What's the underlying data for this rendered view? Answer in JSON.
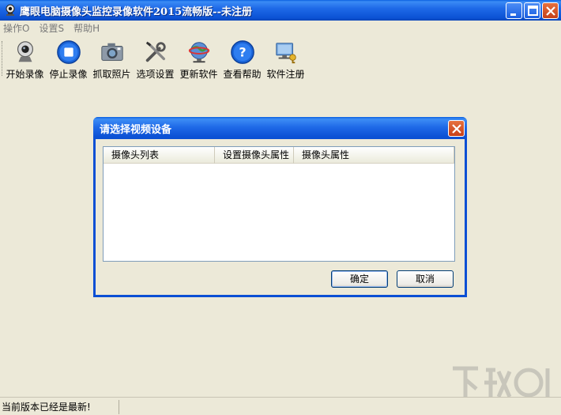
{
  "window": {
    "title": "鹰眼电脑摄像头监控录像软件2015流畅版--未注册"
  },
  "menu": {
    "items": [
      "操作O",
      "设置S",
      "帮助H"
    ]
  },
  "toolbar": {
    "items": [
      {
        "label": "开始录像",
        "icon": "webcam-icon"
      },
      {
        "label": "停止录像",
        "icon": "stop-icon"
      },
      {
        "label": "抓取照片",
        "icon": "camera-icon"
      },
      {
        "label": "选项设置",
        "icon": "tools-icon"
      },
      {
        "label": "更新软件",
        "icon": "globe-icon"
      },
      {
        "label": "查看帮助",
        "icon": "help-icon"
      },
      {
        "label": "软件注册",
        "icon": "register-icon"
      }
    ]
  },
  "dialog": {
    "title": "请选择视频设备",
    "columns": [
      "摄像头列表",
      "设置摄像头属性",
      "摄像头属性"
    ],
    "ok_label": "确定",
    "cancel_label": "取消"
  },
  "status": {
    "text": "当前版本已经是最新!"
  },
  "colors": {
    "titlebar": "#0b51d4",
    "background": "#ece9d8",
    "close_button": "#d2522a"
  }
}
